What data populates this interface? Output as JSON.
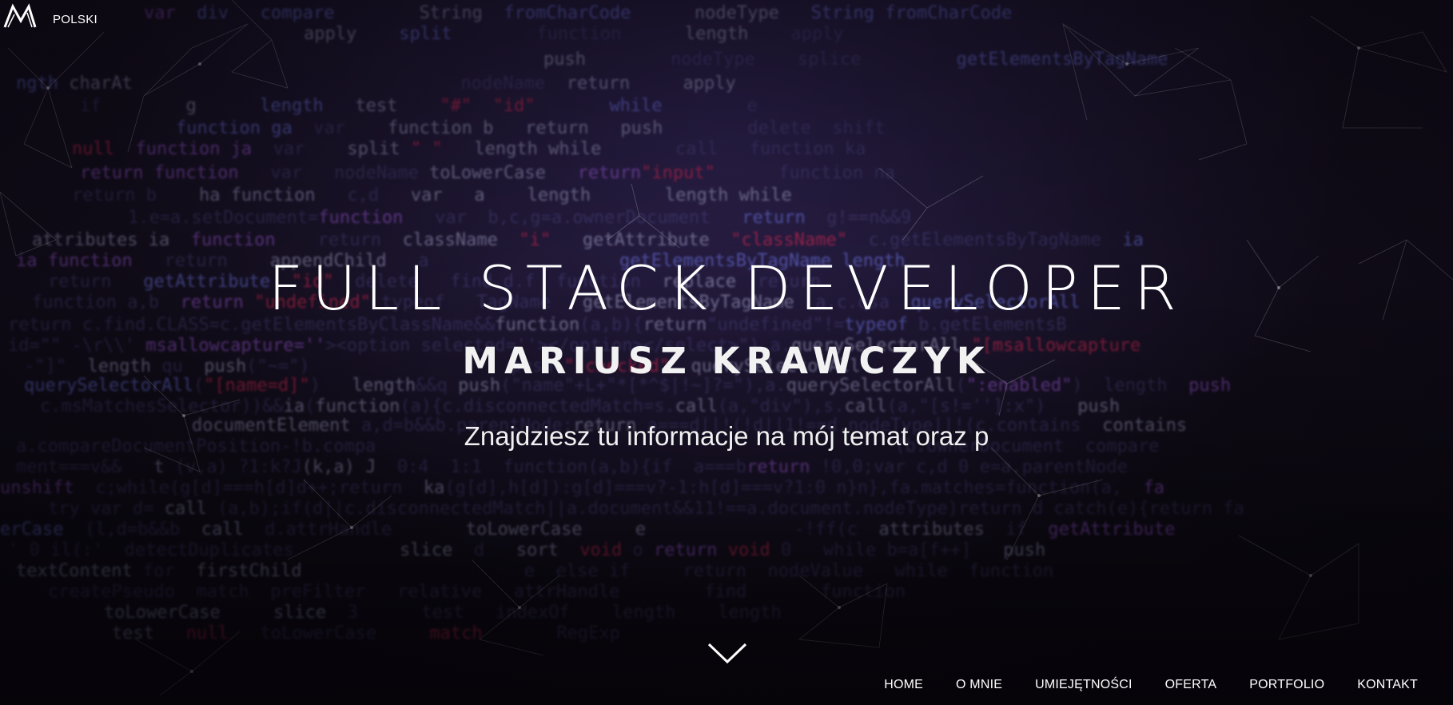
{
  "header": {
    "logo_alt": "M",
    "language": "POLSKI"
  },
  "hero": {
    "title": "FULL STACK DEVELOPER",
    "name": "MARIUSZ KRAWCZYK",
    "subtitle": "Znajdziesz tu informacje na mój temat oraz p"
  },
  "scroll_icon": "chevron-down-icon",
  "nav": {
    "items": [
      {
        "label": "HOME"
      },
      {
        "label": "O MNIE"
      },
      {
        "label": "UMIEJĘTNOŚCI"
      },
      {
        "label": "OFERTA"
      },
      {
        "label": "PORTFOLIO"
      },
      {
        "label": "KONTAKT"
      }
    ]
  },
  "colors": {
    "background": "#120d1a",
    "text": "#ffffff",
    "code_blue": "#6e78eb",
    "code_purple": "#a05adc",
    "code_red": "#d22850"
  }
}
